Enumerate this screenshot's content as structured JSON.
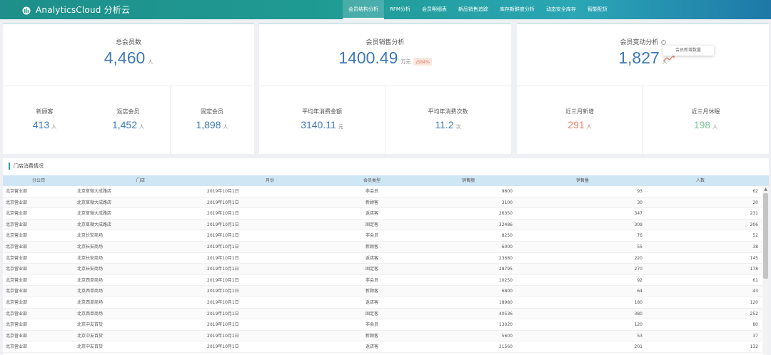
{
  "app": {
    "title": "AnalyticsCloud 分析云",
    "nav": [
      "会员结构分析",
      "RFM分析",
      "会员明细表",
      "新品销售追踪",
      "库存新鲜度分析",
      "动态安全库存",
      "智能配货"
    ],
    "active_nav": 0
  },
  "kpi1": {
    "title": "总会员数",
    "value": "4,460",
    "unit": "人",
    "subs": [
      {
        "label": "新顾客",
        "value": "413",
        "unit": "人"
      },
      {
        "label": "返店会员",
        "value": "1,452",
        "unit": "人"
      },
      {
        "label": "固定会员",
        "value": "1,898",
        "unit": "人"
      }
    ]
  },
  "kpi2": {
    "title": "会员销售分析",
    "value": "1400.49",
    "unit": "万元",
    "badge": "占84%",
    "subs": [
      {
        "label": "平均年消费金额",
        "value": "3140.11",
        "unit": "元"
      },
      {
        "label": "平均年消费次数",
        "value": "11.2",
        "unit": "次"
      }
    ]
  },
  "kpi3": {
    "title": "会员变动分析",
    "help": "?",
    "value": "1,827",
    "unit": "人",
    "tooltip": "会员新增数量",
    "subs": [
      {
        "label": "近三月新增",
        "value": "291",
        "unit": "人",
        "color": "#e8826a"
      },
      {
        "label": "近三月休眠",
        "value": "198",
        "unit": "人",
        "color": "#7cc49a"
      }
    ]
  },
  "section": {
    "title": "门店消费情况",
    "columns": [
      "分公司",
      "门店",
      "月份",
      "会员类型",
      "销售额",
      "销售量",
      "人数"
    ],
    "rows": [
      [
        "北京营业部",
        "北京草微大成路店",
        "2019年10月1日",
        "非会员",
        "9800",
        "93",
        "62"
      ],
      [
        "北京营业部",
        "北京草微大成路店",
        "2019年10月1日",
        "新顾客",
        "3100",
        "30",
        "20"
      ],
      [
        "北京营业部",
        "北京草微大成路店",
        "2019年10月1日",
        "返店客",
        "26350",
        "347",
        "231"
      ],
      [
        "北京营业部",
        "北京草微大成路店",
        "2019年10月1日",
        "固定客",
        "32486",
        "309",
        "206"
      ],
      [
        "北京营业部",
        "北京长安商场",
        "2019年10月1日",
        "非会员",
        "8250",
        "76",
        "52"
      ],
      [
        "北京营业部",
        "北京长安商场",
        "2019年10月1日",
        "新顾客",
        "6000",
        "55",
        "38"
      ],
      [
        "北京营业部",
        "北京长安商场",
        "2019年10月1日",
        "返店客",
        "23680",
        "220",
        "145"
      ],
      [
        "北京营业部",
        "北京长安商场",
        "2019年10月1日",
        "固定客",
        "28795",
        "270",
        "178"
      ],
      [
        "北京营业部",
        "北京西单商场",
        "2019年10月1日",
        "非会员",
        "10250",
        "92",
        "61"
      ],
      [
        "北京营业部",
        "北京西单商场",
        "2019年10月1日",
        "新顾客",
        "6800",
        "64",
        "43"
      ],
      [
        "北京营业部",
        "北京西单商场",
        "2019年10月1日",
        "返店客",
        "18980",
        "180",
        "120"
      ],
      [
        "北京营业部",
        "北京西单商场",
        "2019年10月1日",
        "固定客",
        "40536",
        "380",
        "252"
      ],
      [
        "北京营业部",
        "北京中友百货",
        "2019年10月1日",
        "非会员",
        "13020",
        "120",
        "80"
      ],
      [
        "北京营业部",
        "北京中友百货",
        "2019年10月1日",
        "新顾客",
        "5600",
        "53",
        "37"
      ],
      [
        "北京营业部",
        "北京中友百货",
        "2019年10月1日",
        "返店客",
        "21560",
        "201",
        "132"
      ]
    ]
  },
  "colors": {
    "accent": "#3f7ab8",
    "header_bg": "#cfe6f5",
    "brand": "#1f9a92"
  }
}
